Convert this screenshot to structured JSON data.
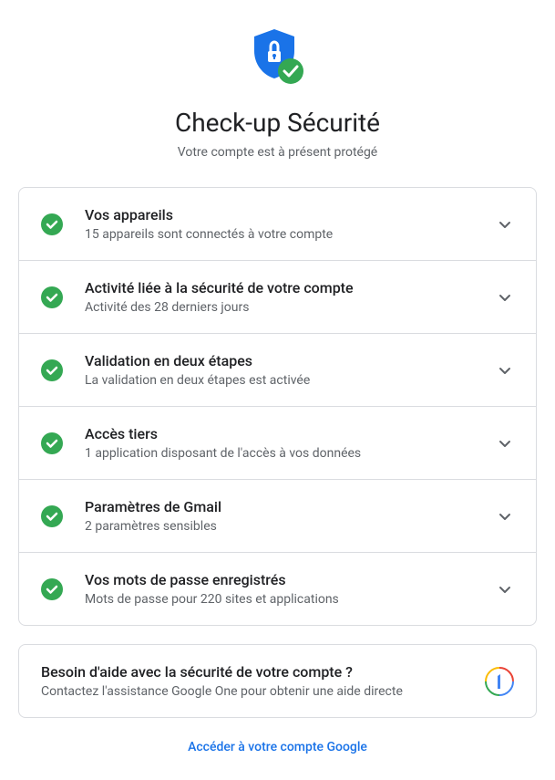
{
  "header": {
    "title": "Check-up Sécurité",
    "subtitle": "Votre compte est à présent protégé"
  },
  "items": [
    {
      "title": "Vos appareils",
      "desc": "15 appareils sont connectés à votre compte"
    },
    {
      "title": "Activité liée à la sécurité de votre compte",
      "desc": "Activité des 28 derniers jours"
    },
    {
      "title": "Validation en deux étapes",
      "desc": "La validation en deux étapes est activée"
    },
    {
      "title": "Accès tiers",
      "desc": "1 application disposant de l'accès à vos données"
    },
    {
      "title": "Paramètres de Gmail",
      "desc": "2 paramètres sensibles"
    },
    {
      "title": "Vos mots de passe enregistrés",
      "desc": "Mots de passe pour 220 sites et applications"
    }
  ],
  "help": {
    "title": "Besoin d'aide avec la sécurité de votre compte ?",
    "desc": "Contactez l'assistance Google One pour obtenir une aide directe"
  },
  "footer": {
    "link": "Accéder à votre compte Google"
  }
}
